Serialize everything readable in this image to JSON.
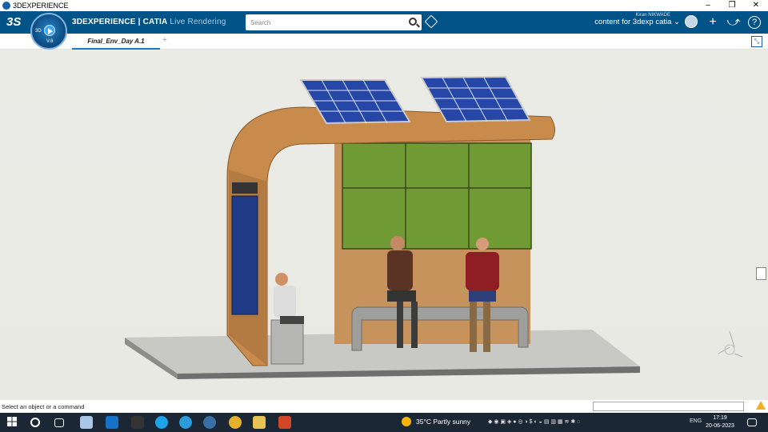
{
  "window": {
    "title": "3DEXPERIENCE",
    "controls": [
      "–",
      "❐",
      "✕"
    ]
  },
  "topbar": {
    "brand_main": "3DEXPERIENCE | CATIA",
    "brand_sub": "Live Rendering",
    "compass_3d": "3D",
    "compass_version": "V.6",
    "search_placeholder": "Search",
    "user_name": "Kiran NIKWADE",
    "context": "content for 3dexp catia ⌄",
    "icons": [
      "tag-icon",
      "avatar",
      "plus-icon",
      "share-icon",
      "help-icon"
    ],
    "plus": "+",
    "share": "⤻",
    "help": "?",
    "ds_logo": "3S"
  },
  "tabs": [
    {
      "label": "Final_Env_Day A.1"
    }
  ],
  "tab_add": "+",
  "statusbar": {
    "message": "Select an object or a command"
  },
  "taskbar": {
    "weather_temp": "35°C",
    "weather_desc": "Partly sunny",
    "lang": "ENG",
    "time": "17:19",
    "date": "20-06-2023"
  },
  "colors": {
    "topbar": "#005386",
    "accent": "#1b7ac3",
    "taskbar": "#1c2736"
  }
}
